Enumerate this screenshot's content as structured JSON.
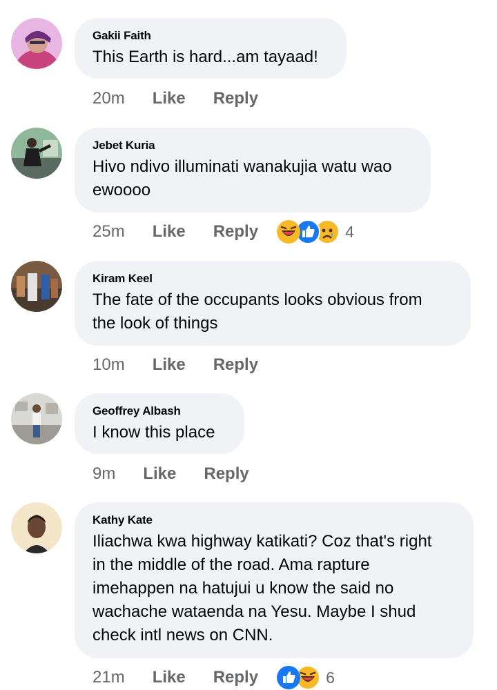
{
  "comments": [
    {
      "author": "Gakii Faith",
      "text": "This Earth is hard...am tayaad!",
      "time": "20m",
      "like": "Like",
      "reply": "Reply",
      "reaction_count": ""
    },
    {
      "author": "Jebet Kuria",
      "text_lines": [
        "Hivo ndivo illuminati wanakujia watu wao",
        "ewoooo"
      ],
      "time": "25m",
      "like": "Like",
      "reply": "Reply",
      "reactions": [
        "laugh-react-icon",
        "like-react-icon",
        "sad-react-icon"
      ],
      "reaction_count": "4"
    },
    {
      "author": "Kiram Keel",
      "text_lines": [
        "The fate of the occupants looks obvious from",
        "the look of things"
      ],
      "time": "10m",
      "like": "Like",
      "reply": "Reply",
      "reaction_count": ""
    },
    {
      "author": "Geoffrey Albash",
      "text": "I know this place",
      "time": "9m",
      "like": "Like",
      "reply": "Reply",
      "reaction_count": ""
    },
    {
      "author": "Kathy Kate",
      "text_lines": [
        "Iliachwa kwa highway katikati? Coz that's right",
        "in the middle of the road. Ama rapture",
        "imehappen na hatujui u know the said no",
        "wachache wataenda na Yesu. Maybe I shud",
        "check intl news on CNN."
      ],
      "time": "21m",
      "like": "Like",
      "reply": "Reply",
      "reactions": [
        "like-react-icon",
        "laugh-react-icon"
      ],
      "reaction_count": "6"
    }
  ],
  "colors": {
    "bubble": "#f0f2f5",
    "meta_text": "#65676b",
    "like_blue": "#1877f2",
    "haha_yellow": "#f7b928"
  }
}
